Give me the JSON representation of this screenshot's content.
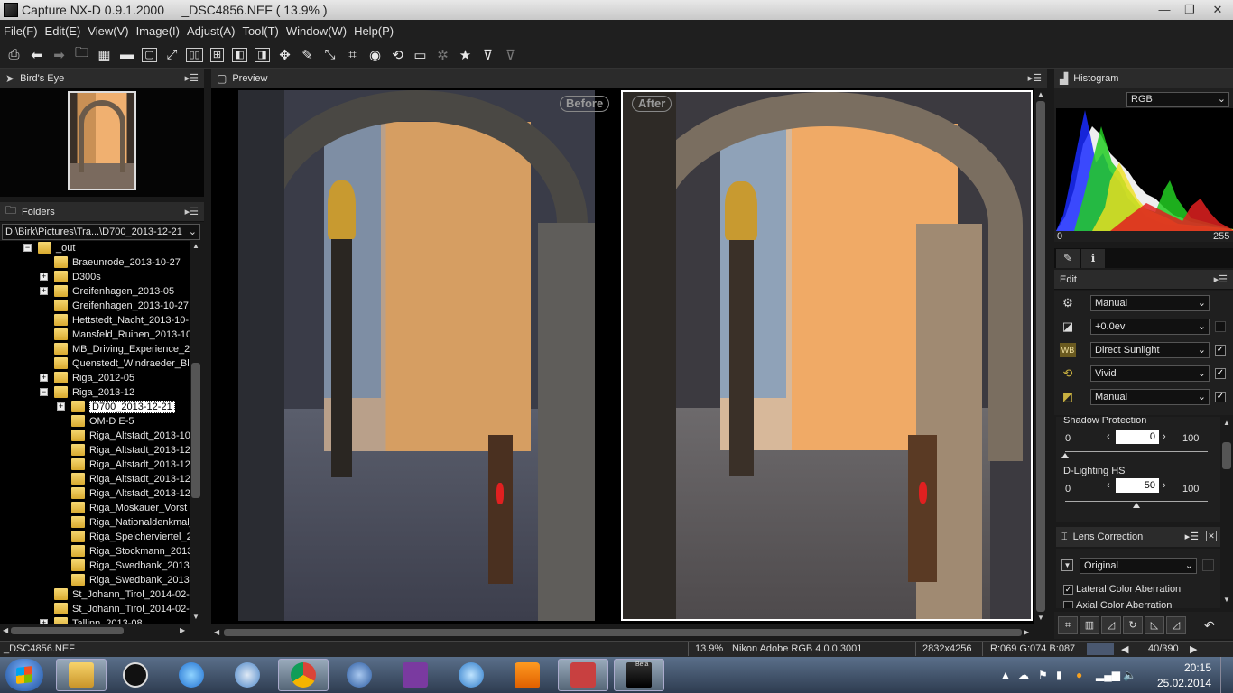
{
  "window": {
    "title": "Capture NX-D 0.9.1.2000     _DSC4856.NEF ( 13.9% )",
    "minimize_icon": "minimize-icon",
    "restore_icon": "restore-icon",
    "close_icon": "close-icon"
  },
  "menu": [
    {
      "label": "File(F)"
    },
    {
      "label": "Edit(E)"
    },
    {
      "label": "View(V)"
    },
    {
      "label": "Image(I)"
    },
    {
      "label": "Adjust(A)"
    },
    {
      "label": "Tool(T)"
    },
    {
      "label": "Window(W)"
    },
    {
      "label": "Help(P)"
    }
  ],
  "toolbar": {
    "icons": [
      "print-icon",
      "back-icon",
      "forward-icon",
      "open-folder-icon",
      "thumbnail-grid-icon",
      "filmstrip-icon",
      "single-view-icon",
      "fullscreen-icon",
      "compare-two-icon",
      "compare-four-icon",
      "before-after-icon",
      "before-after-split-icon",
      "hand-icon",
      "picker-icon",
      "straighten-icon",
      "crop-icon",
      "auto-retouch-icon",
      "rotate-icon",
      "display-icon",
      "settings-icon",
      "star-icon",
      "filter-icon",
      "filter-clear-icon"
    ]
  },
  "birds_eye": {
    "title": "Bird's Eye"
  },
  "folders": {
    "title": "Folders",
    "path": "D:\\Birk\\Pictures\\Tra...\\D700_2013-12-21",
    "items": [
      {
        "label": "_out",
        "expander": "−"
      },
      {
        "label": "Braeunrode_2013-10-27",
        "expander": ""
      },
      {
        "label": "D300s",
        "expander": "+"
      },
      {
        "label": "Greifenhagen_2013-05",
        "expander": "+"
      },
      {
        "label": "Greifenhagen_2013-10-27",
        "expander": ""
      },
      {
        "label": "Hettstedt_Nacht_2013-10-",
        "expander": ""
      },
      {
        "label": "Mansfeld_Ruinen_2013-10",
        "expander": ""
      },
      {
        "label": "MB_Driving_Experience_2",
        "expander": ""
      },
      {
        "label": "Quenstedt_Windraeder_Bl",
        "expander": ""
      },
      {
        "label": "Riga_2012-05",
        "expander": "+"
      },
      {
        "label": "Riga_2013-12",
        "expander": "−"
      },
      {
        "label": "D700_2013-12-21",
        "expander": "+"
      },
      {
        "label": "OM-D E-5",
        "expander": ""
      },
      {
        "label": "Riga_Altstadt_2013-10",
        "expander": ""
      },
      {
        "label": "Riga_Altstadt_2013-12",
        "expander": ""
      },
      {
        "label": "Riga_Altstadt_2013-12",
        "expander": ""
      },
      {
        "label": "Riga_Altstadt_2013-12",
        "expander": ""
      },
      {
        "label": "Riga_Altstadt_2013-12",
        "expander": ""
      },
      {
        "label": "Riga_Moskauer_Vorst",
        "expander": ""
      },
      {
        "label": "Riga_Nationaldenkmal_",
        "expander": ""
      },
      {
        "label": "Riga_Speicherviertel_2",
        "expander": ""
      },
      {
        "label": "Riga_Stockmann_2013",
        "expander": ""
      },
      {
        "label": "Riga_Swedbank_2013",
        "expander": ""
      },
      {
        "label": "Riga_Swedbank_2013",
        "expander": ""
      },
      {
        "label": "St_Johann_Tirol_2014-02-",
        "expander": ""
      },
      {
        "label": "St_Johann_Tirol_2014-02-",
        "expander": ""
      },
      {
        "label": "Tallinn_2013-08",
        "expander": "+"
      }
    ]
  },
  "preview": {
    "title": "Preview",
    "before_label": "Before",
    "after_label": "After"
  },
  "histogram": {
    "title": "Histogram",
    "channel": "RGB",
    "min_label": "0",
    "max_label": "255"
  },
  "edit": {
    "title": "Edit",
    "rows": [
      {
        "icon": "gear-icon",
        "value": "Manual",
        "checked": ""
      },
      {
        "icon": "exposure-icon",
        "value": "+0.0ev",
        "checked": ""
      },
      {
        "icon": "white-balance-icon",
        "value": "Direct Sunlight",
        "checked": "✓"
      },
      {
        "icon": "picture-control-icon",
        "value": "Vivid",
        "checked": "✓"
      },
      {
        "icon": "tone-icon",
        "value": "Manual",
        "checked": "✓"
      }
    ],
    "shadow_protection": {
      "label": "Shadow Protection",
      "min": "0",
      "value": "0",
      "max": "100"
    },
    "d_lighting": {
      "label": "D-Lighting HS",
      "min": "0",
      "value": "50",
      "max": "100"
    }
  },
  "lens_correction": {
    "title": "Lens Correction",
    "mode": "Original",
    "lateral_ca": {
      "label": "Lateral Color Aberration",
      "checked": "✓"
    },
    "axial_ca": {
      "label": "Axial Color Aberration",
      "checked": ""
    }
  },
  "status": {
    "filename": "_DSC4856.NEF",
    "zoom": "13.9%",
    "profile": "Nikon Adobe RGB 4.0.0.3001",
    "dimensions": "2832x4256",
    "rgb": "R:069 G:074 B:087",
    "page": "40/390"
  },
  "taskbar": {
    "apps": [
      "explorer-icon",
      "ccleaner-icon",
      "internet-explorer-icon",
      "safari-icon",
      "chrome-icon",
      "thunderbird-icon",
      "onenote-icon",
      "itunes-icon",
      "vlc-icon",
      "snipping-tool-icon",
      "capture-nxd-icon"
    ],
    "active_app_label": "Beta",
    "time": "20:15",
    "date": "25.02.2014"
  },
  "colors": {
    "accent": "#e6e6e6",
    "panel_bg": "#1f1f1f",
    "histogram_red": "#e02020",
    "histogram_green": "#22cc22",
    "histogram_blue": "#1a2cff",
    "histogram_yellow": "#f0e020"
  }
}
